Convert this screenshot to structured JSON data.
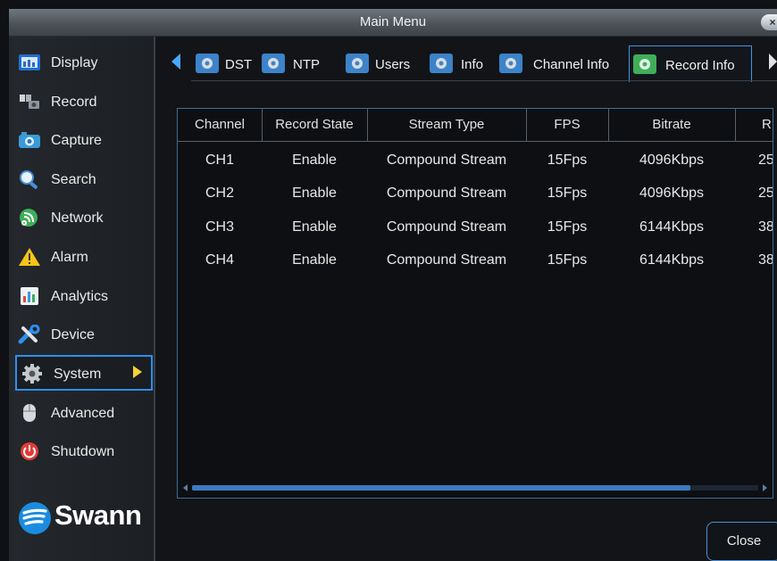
{
  "window": {
    "title": "Main Menu",
    "close_glyph": "×"
  },
  "sidebar": {
    "items": [
      {
        "label": "Display",
        "icon": "display-icon"
      },
      {
        "label": "Record",
        "icon": "record-icon"
      },
      {
        "label": "Capture",
        "icon": "camera-icon"
      },
      {
        "label": "Search",
        "icon": "search-icon"
      },
      {
        "label": "Network",
        "icon": "network-icon"
      },
      {
        "label": "Alarm",
        "icon": "alarm-icon"
      },
      {
        "label": "Analytics",
        "icon": "analytics-icon"
      },
      {
        "label": "Device",
        "icon": "device-icon"
      },
      {
        "label": "System",
        "icon": "gear-icon",
        "active": true
      },
      {
        "label": "Advanced",
        "icon": "mouse-icon"
      },
      {
        "label": "Shutdown",
        "icon": "power-icon"
      }
    ],
    "logo": "Swann"
  },
  "tabs": [
    {
      "label": "DST"
    },
    {
      "label": "NTP"
    },
    {
      "label": "Users"
    },
    {
      "label": "Info"
    },
    {
      "label": "Channel Info"
    },
    {
      "label": "Record Info",
      "active": true
    }
  ],
  "table": {
    "headers": [
      "Channel",
      "Record State",
      "Stream Type",
      "FPS",
      "Bitrate",
      "R"
    ],
    "rows": [
      [
        "CH1",
        "Enable",
        "Compound Stream",
        "15Fps",
        "4096Kbps",
        "25"
      ],
      [
        "CH2",
        "Enable",
        "Compound Stream",
        "15Fps",
        "4096Kbps",
        "25"
      ],
      [
        "CH3",
        "Enable",
        "Compound Stream",
        "15Fps",
        "6144Kbps",
        "38"
      ],
      [
        "CH4",
        "Enable",
        "Compound Stream",
        "15Fps",
        "6144Kbps",
        "38"
      ]
    ]
  },
  "buttons": {
    "close": "Close"
  },
  "colors": {
    "accent": "#2e8ff0",
    "active_arrow": "#f2d23a"
  }
}
